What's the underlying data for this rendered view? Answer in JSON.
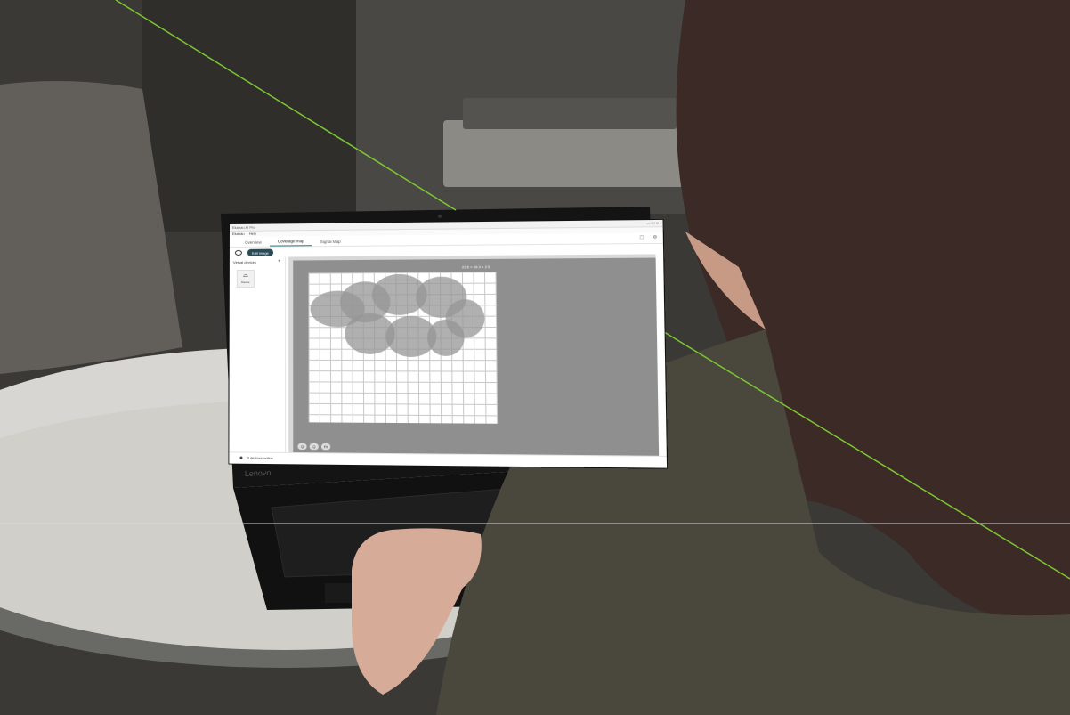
{
  "app": {
    "title_bar": "Ekahau AI Pro",
    "menu": [
      "Ekahau",
      "Help"
    ],
    "tabs": [
      {
        "label": "Overview",
        "active": false
      },
      {
        "label": "Coverage map",
        "active": true
      },
      {
        "label": "Signal Map",
        "active": false
      }
    ],
    "toolbar": {
      "edit_button": "Edit image"
    },
    "sidebar": {
      "header": "Virtual devices",
      "device_label": "Device"
    },
    "canvas": {
      "dimension_label": "22.6 × 16.3 × 2.5"
    },
    "zoom_controls": [
      "Q",
      "Q",
      "Fit"
    ],
    "status": {
      "text": "3 devices online"
    }
  },
  "laptop_brand": "Lenovo",
  "colors": {
    "accent_line": "#7cc532",
    "tab_active": "#2a7c85",
    "button": "#2c4a55"
  }
}
